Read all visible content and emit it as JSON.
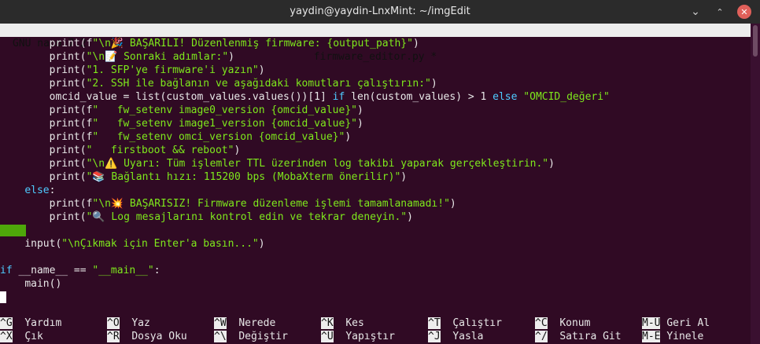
{
  "window": {
    "title": "yaydin@yaydin-LnxMint: ~/imgEdit"
  },
  "nano": {
    "version": "GNU nano 7.2",
    "filename": "firmware_editor.py *"
  },
  "code_lines": [
    [
      [
        "",
        "        "
      ],
      [
        "fn",
        "print(f"
      ],
      [
        "str",
        "\"\\n🎉 BAŞARILI! Düzenlenmiş firmware: {output_path}\""
      ],
      [
        "fn",
        ")"
      ]
    ],
    [
      [
        "",
        "        "
      ],
      [
        "fn",
        "print("
      ],
      [
        "str",
        "\"\\n📝 Sonraki adımlar:\""
      ],
      [
        "fn",
        ")"
      ]
    ],
    [
      [
        "",
        "        "
      ],
      [
        "fn",
        "print("
      ],
      [
        "str",
        "\"1. SFP'ye firmware'i yazın\""
      ],
      [
        "fn",
        ")"
      ]
    ],
    [
      [
        "",
        "        "
      ],
      [
        "fn",
        "print("
      ],
      [
        "str",
        "\"2. SSH ile bağlanın ve aşağıdaki komutları çalıştırın:\""
      ],
      [
        "fn",
        ")"
      ]
    ],
    [
      [
        "",
        "        "
      ],
      [
        "fn",
        "omcid_value = list(custom_values.values())[1] "
      ],
      [
        "kw",
        "if"
      ],
      [
        "fn",
        " len(custom_values) > 1 "
      ],
      [
        "kw",
        "else"
      ],
      [
        "fn",
        " "
      ],
      [
        "str",
        "\"OMCID_değeri\""
      ]
    ],
    [
      [
        "",
        "        "
      ],
      [
        "fn",
        "print(f"
      ],
      [
        "str",
        "\"   fw_setenv image0_version {omcid_value}\""
      ],
      [
        "fn",
        ")"
      ]
    ],
    [
      [
        "",
        "        "
      ],
      [
        "fn",
        "print(f"
      ],
      [
        "str",
        "\"   fw_setenv image1_version {omcid_value}\""
      ],
      [
        "fn",
        ")"
      ]
    ],
    [
      [
        "",
        "        "
      ],
      [
        "fn",
        "print(f"
      ],
      [
        "str",
        "\"   fw_setenv omci_version {omcid_value}\""
      ],
      [
        "fn",
        ")"
      ]
    ],
    [
      [
        "",
        "        "
      ],
      [
        "fn",
        "print("
      ],
      [
        "str",
        "\"   firstboot && reboot\""
      ],
      [
        "fn",
        ")"
      ]
    ],
    [
      [
        "",
        "        "
      ],
      [
        "fn",
        "print("
      ],
      [
        "str",
        "\"\\n⚠️ Uyarı: Tüm işlemler TTL üzerinden log takibi yaparak gerçekleştirin.\""
      ],
      [
        "fn",
        ")"
      ]
    ],
    [
      [
        "",
        "        "
      ],
      [
        "fn",
        "print("
      ],
      [
        "str",
        "\"📚 Bağlantı hızı: 115200 bps (MobaXterm önerilir)\""
      ],
      [
        "fn",
        ")"
      ]
    ],
    [
      [
        "",
        "    "
      ],
      [
        "kw",
        "else"
      ],
      [
        "fn",
        ":"
      ]
    ],
    [
      [
        "",
        "        "
      ],
      [
        "fn",
        "print(f"
      ],
      [
        "str",
        "\"\\n💥 BAŞARISIZ! Firmware düzenleme işlemi tamamlanamadı!\""
      ],
      [
        "fn",
        ")"
      ]
    ],
    [
      [
        "",
        "        "
      ],
      [
        "fn",
        "print("
      ],
      [
        "str",
        "\"🔍 Log mesajlarını kontrol edin ve tekrar deneyin.\""
      ],
      [
        "fn",
        ")"
      ]
    ],
    [
      [
        "",
        ""
      ]
    ],
    [
      [
        "",
        "    "
      ],
      [
        "fn",
        "input("
      ],
      [
        "str",
        "\"\\nÇıkmak için Enter'a basın...\""
      ],
      [
        "fn",
        ")"
      ]
    ],
    [
      [
        "",
        ""
      ]
    ],
    [
      [
        "kw",
        "if"
      ],
      [
        "fn",
        " __name__ == "
      ],
      [
        "str",
        "\"__main__\""
      ],
      [
        "fn",
        ":"
      ]
    ],
    [
      [
        "",
        "    "
      ],
      [
        "fn",
        "main()"
      ]
    ],
    [
      [
        "",
        ""
      ]
    ]
  ],
  "shortcuts": {
    "row1": [
      {
        "key": "^G",
        "label": "Yardım"
      },
      {
        "key": "^O",
        "label": "Yaz"
      },
      {
        "key": "^W",
        "label": "Nerede"
      },
      {
        "key": "^K",
        "label": "Kes"
      },
      {
        "key": "^T",
        "label": "Çalıştır"
      },
      {
        "key": "^C",
        "label": "Konum"
      },
      {
        "key": "M-U",
        "label": "Geri Al"
      }
    ],
    "row2": [
      {
        "key": "^X",
        "label": "Çık"
      },
      {
        "key": "^R",
        "label": "Dosya Oku"
      },
      {
        "key": "^\\",
        "label": "Değiştir"
      },
      {
        "key": "^U",
        "label": "Yapıştır"
      },
      {
        "key": "^J",
        "label": "Yasla"
      },
      {
        "key": "^/",
        "label": "Satıra Git"
      },
      {
        "key": "M-E",
        "label": "Yinele"
      }
    ]
  },
  "colors": {
    "keyword": "#4ecbff",
    "string": "#7ee81c",
    "background": "#300a24"
  },
  "icons": [
    "minimize-icon",
    "maximize-icon",
    "close-icon"
  ]
}
